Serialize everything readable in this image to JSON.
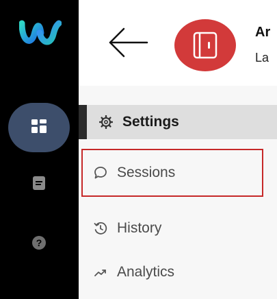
{
  "rail": {
    "logo_icon": "webex-logo",
    "items": [
      {
        "icon": "apps-grid-icon",
        "active": true
      },
      {
        "icon": "message-icon"
      },
      {
        "icon": "help-icon",
        "glyph": "?"
      }
    ]
  },
  "header": {
    "back_icon": "arrow-left-icon",
    "avatar_color": "#d23a3a",
    "title": "Ar",
    "subtitle": "La"
  },
  "nav": {
    "settings_label": "Settings",
    "items": [
      {
        "label": "Sessions",
        "icon": "chat-bubble-icon",
        "highlighted": true
      },
      {
        "label": "History",
        "icon": "history-icon"
      },
      {
        "label": "Analytics",
        "icon": "trend-icon"
      }
    ]
  },
  "colors": {
    "rail_bg": "#000000",
    "rail_active_bg": "#3d4e6b",
    "highlight_border": "#c62828",
    "settings_bg": "#dedede"
  }
}
